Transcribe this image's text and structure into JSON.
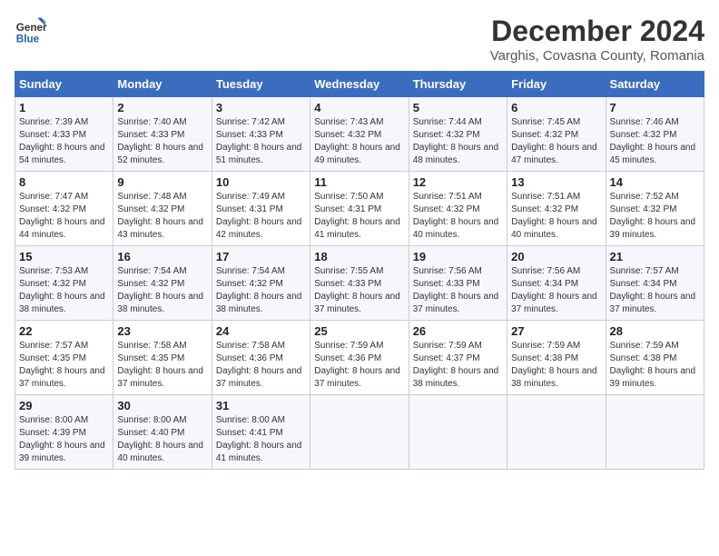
{
  "header": {
    "logo_line1": "General",
    "logo_line2": "Blue",
    "title": "December 2024",
    "subtitle": "Varghis, Covasna County, Romania"
  },
  "days_of_week": [
    "Sunday",
    "Monday",
    "Tuesday",
    "Wednesday",
    "Thursday",
    "Friday",
    "Saturday"
  ],
  "weeks": [
    [
      {
        "day": "1",
        "sunrise": "Sunrise: 7:39 AM",
        "sunset": "Sunset: 4:33 PM",
        "daylight": "Daylight: 8 hours and 54 minutes."
      },
      {
        "day": "2",
        "sunrise": "Sunrise: 7:40 AM",
        "sunset": "Sunset: 4:33 PM",
        "daylight": "Daylight: 8 hours and 52 minutes."
      },
      {
        "day": "3",
        "sunrise": "Sunrise: 7:42 AM",
        "sunset": "Sunset: 4:33 PM",
        "daylight": "Daylight: 8 hours and 51 minutes."
      },
      {
        "day": "4",
        "sunrise": "Sunrise: 7:43 AM",
        "sunset": "Sunset: 4:32 PM",
        "daylight": "Daylight: 8 hours and 49 minutes."
      },
      {
        "day": "5",
        "sunrise": "Sunrise: 7:44 AM",
        "sunset": "Sunset: 4:32 PM",
        "daylight": "Daylight: 8 hours and 48 minutes."
      },
      {
        "day": "6",
        "sunrise": "Sunrise: 7:45 AM",
        "sunset": "Sunset: 4:32 PM",
        "daylight": "Daylight: 8 hours and 47 minutes."
      },
      {
        "day": "7",
        "sunrise": "Sunrise: 7:46 AM",
        "sunset": "Sunset: 4:32 PM",
        "daylight": "Daylight: 8 hours and 45 minutes."
      }
    ],
    [
      {
        "day": "8",
        "sunrise": "Sunrise: 7:47 AM",
        "sunset": "Sunset: 4:32 PM",
        "daylight": "Daylight: 8 hours and 44 minutes."
      },
      {
        "day": "9",
        "sunrise": "Sunrise: 7:48 AM",
        "sunset": "Sunset: 4:32 PM",
        "daylight": "Daylight: 8 hours and 43 minutes."
      },
      {
        "day": "10",
        "sunrise": "Sunrise: 7:49 AM",
        "sunset": "Sunset: 4:31 PM",
        "daylight": "Daylight: 8 hours and 42 minutes."
      },
      {
        "day": "11",
        "sunrise": "Sunrise: 7:50 AM",
        "sunset": "Sunset: 4:31 PM",
        "daylight": "Daylight: 8 hours and 41 minutes."
      },
      {
        "day": "12",
        "sunrise": "Sunrise: 7:51 AM",
        "sunset": "Sunset: 4:32 PM",
        "daylight": "Daylight: 8 hours and 40 minutes."
      },
      {
        "day": "13",
        "sunrise": "Sunrise: 7:51 AM",
        "sunset": "Sunset: 4:32 PM",
        "daylight": "Daylight: 8 hours and 40 minutes."
      },
      {
        "day": "14",
        "sunrise": "Sunrise: 7:52 AM",
        "sunset": "Sunset: 4:32 PM",
        "daylight": "Daylight: 8 hours and 39 minutes."
      }
    ],
    [
      {
        "day": "15",
        "sunrise": "Sunrise: 7:53 AM",
        "sunset": "Sunset: 4:32 PM",
        "daylight": "Daylight: 8 hours and 38 minutes."
      },
      {
        "day": "16",
        "sunrise": "Sunrise: 7:54 AM",
        "sunset": "Sunset: 4:32 PM",
        "daylight": "Daylight: 8 hours and 38 minutes."
      },
      {
        "day": "17",
        "sunrise": "Sunrise: 7:54 AM",
        "sunset": "Sunset: 4:32 PM",
        "daylight": "Daylight: 8 hours and 38 minutes."
      },
      {
        "day": "18",
        "sunrise": "Sunrise: 7:55 AM",
        "sunset": "Sunset: 4:33 PM",
        "daylight": "Daylight: 8 hours and 37 minutes."
      },
      {
        "day": "19",
        "sunrise": "Sunrise: 7:56 AM",
        "sunset": "Sunset: 4:33 PM",
        "daylight": "Daylight: 8 hours and 37 minutes."
      },
      {
        "day": "20",
        "sunrise": "Sunrise: 7:56 AM",
        "sunset": "Sunset: 4:34 PM",
        "daylight": "Daylight: 8 hours and 37 minutes."
      },
      {
        "day": "21",
        "sunrise": "Sunrise: 7:57 AM",
        "sunset": "Sunset: 4:34 PM",
        "daylight": "Daylight: 8 hours and 37 minutes."
      }
    ],
    [
      {
        "day": "22",
        "sunrise": "Sunrise: 7:57 AM",
        "sunset": "Sunset: 4:35 PM",
        "daylight": "Daylight: 8 hours and 37 minutes."
      },
      {
        "day": "23",
        "sunrise": "Sunrise: 7:58 AM",
        "sunset": "Sunset: 4:35 PM",
        "daylight": "Daylight: 8 hours and 37 minutes."
      },
      {
        "day": "24",
        "sunrise": "Sunrise: 7:58 AM",
        "sunset": "Sunset: 4:36 PM",
        "daylight": "Daylight: 8 hours and 37 minutes."
      },
      {
        "day": "25",
        "sunrise": "Sunrise: 7:59 AM",
        "sunset": "Sunset: 4:36 PM",
        "daylight": "Daylight: 8 hours and 37 minutes."
      },
      {
        "day": "26",
        "sunrise": "Sunrise: 7:59 AM",
        "sunset": "Sunset: 4:37 PM",
        "daylight": "Daylight: 8 hours and 38 minutes."
      },
      {
        "day": "27",
        "sunrise": "Sunrise: 7:59 AM",
        "sunset": "Sunset: 4:38 PM",
        "daylight": "Daylight: 8 hours and 38 minutes."
      },
      {
        "day": "28",
        "sunrise": "Sunrise: 7:59 AM",
        "sunset": "Sunset: 4:38 PM",
        "daylight": "Daylight: 8 hours and 39 minutes."
      }
    ],
    [
      {
        "day": "29",
        "sunrise": "Sunrise: 8:00 AM",
        "sunset": "Sunset: 4:39 PM",
        "daylight": "Daylight: 8 hours and 39 minutes."
      },
      {
        "day": "30",
        "sunrise": "Sunrise: 8:00 AM",
        "sunset": "Sunset: 4:40 PM",
        "daylight": "Daylight: 8 hours and 40 minutes."
      },
      {
        "day": "31",
        "sunrise": "Sunrise: 8:00 AM",
        "sunset": "Sunset: 4:41 PM",
        "daylight": "Daylight: 8 hours and 41 minutes."
      },
      null,
      null,
      null,
      null
    ]
  ]
}
